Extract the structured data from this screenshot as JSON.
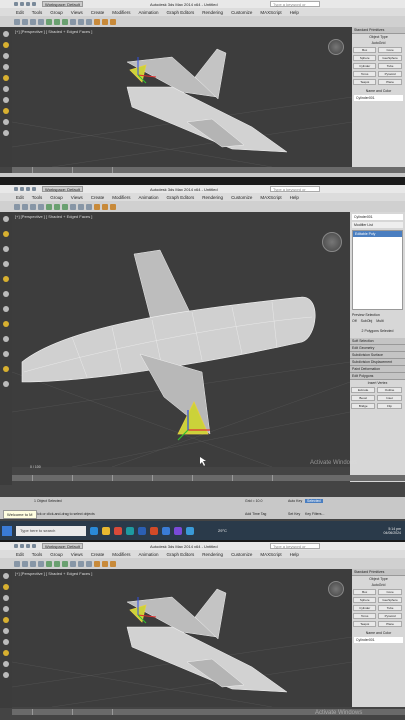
{
  "app": {
    "title": "Autodesk 3ds Max 2014 x64 - Untitled",
    "workspace": "Workspace: Default",
    "search_placeholder": "Type a keyword or phrase"
  },
  "menu": [
    "Edit",
    "Tools",
    "Group",
    "Views",
    "Create",
    "Modifiers",
    "Animation",
    "Graph Editors",
    "Rendering",
    "Customize",
    "MAXScript",
    "Help"
  ],
  "viewport": {
    "label": "[+] [Perspective ] [ Shaded + Edged Faces ]"
  },
  "command_panel": {
    "object_name": "Cylinder001",
    "modifier_list": "Modifier List",
    "stack_item": "Editable Poly",
    "rollouts": [
      "Standard Primitives",
      "Object Type",
      "Name and Color",
      "Selection",
      "Soft Selection",
      "Edit Geometry",
      "Subdivision Surface",
      "Subdivision Displacement",
      "Paint Deformation",
      "Edit Polygons"
    ],
    "object_type_buttons": [
      "AutoGrid",
      "Box",
      "Cone",
      "Sphere",
      "GeoSphere",
      "Cylinder",
      "Tube",
      "Torus",
      "Pyramid",
      "Teapot",
      "Plane"
    ],
    "selection_info": "2 Polygons Selected",
    "edit_polygon_buttons": [
      "Insert Vertex",
      "Extrude",
      "Outline",
      "Bevel",
      "Inset",
      "Bridge",
      "Flip"
    ],
    "preview_selection": "Preview Selection",
    "preview_options": [
      "Off",
      "SubObj",
      "Multi"
    ]
  },
  "status": {
    "objects_selected": "1 Object Selected",
    "prompt_a": "Click or click-and-drag to select objects",
    "prompt_b": "Click or click-and-drag to select objects",
    "grid": "Grid = 10.0",
    "auto_key": "Auto Key",
    "selected": "Selected",
    "set_key": "Set Key",
    "key_filters": "Key Filters...",
    "add_time_tag": "Add Time Tag",
    "frame": "0 / 100"
  },
  "tooltip": "Welcome to M",
  "taskbar": {
    "search": "Type here to search",
    "weather": "29°C",
    "time": "5:14 pm",
    "date": "04/06/2024"
  },
  "watermark": "Activate Windows",
  "colors": {
    "viewport_bg": "#3d3d3d",
    "selection_yellow": "#e8d040",
    "axis_red": "#e03030",
    "axis_green": "#30c030",
    "axis_blue": "#3050e0",
    "mesh_gray": "#c8c8c8"
  },
  "icons": [
    "start-icon",
    "search-icon",
    "edge-icon",
    "folder-icon",
    "chrome-icon",
    "3dsmax-icon",
    "word-icon",
    "powerpoint-icon",
    "explorer-icon",
    "store-icon",
    "mail-icon"
  ]
}
